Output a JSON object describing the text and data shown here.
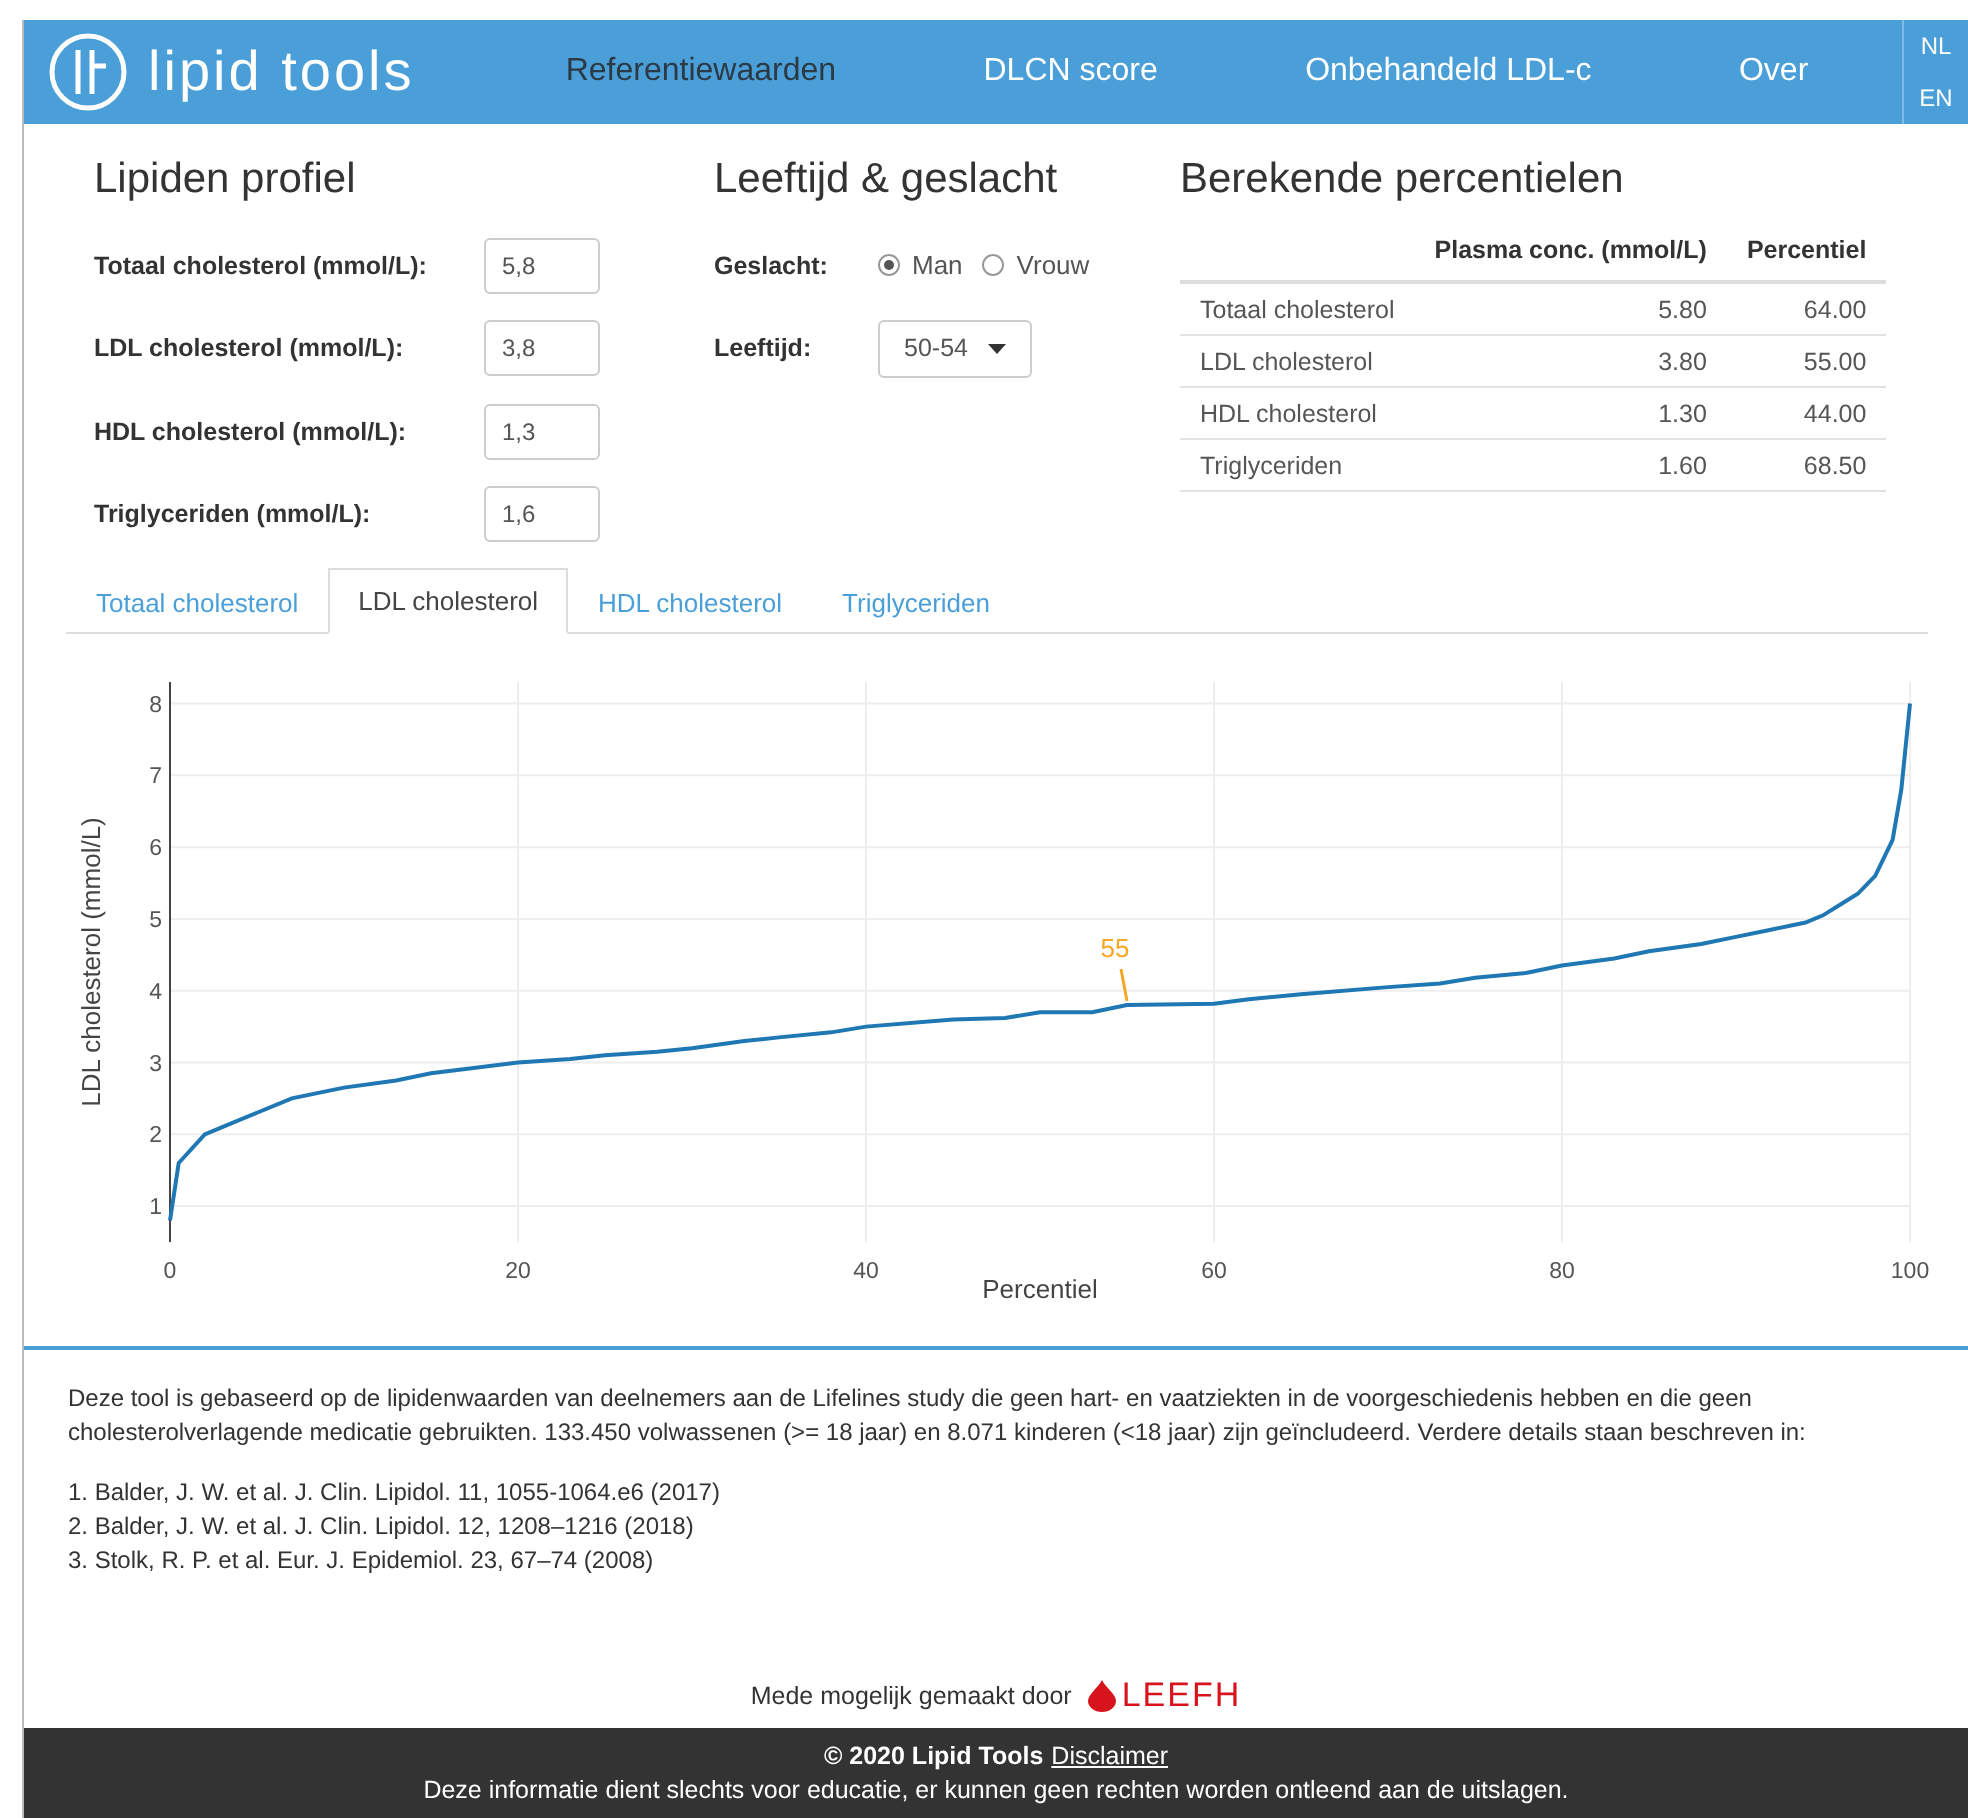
{
  "header": {
    "logo_text": "lipid tools",
    "nav": [
      {
        "label": "Referentiewaarden",
        "selected": true
      },
      {
        "label": "DLCN score",
        "selected": false
      },
      {
        "label": "Onbehandeld LDL-c",
        "selected": false
      },
      {
        "label": "Over",
        "selected": false
      }
    ],
    "languages": [
      "NL",
      "EN"
    ]
  },
  "lipid_profile": {
    "title": "Lipiden profiel",
    "fields": [
      {
        "label": "Totaal cholesterol (mmol/L):",
        "value": "5,8"
      },
      {
        "label": "LDL cholesterol (mmol/L):",
        "value": "3,8"
      },
      {
        "label": "HDL cholesterol (mmol/L):",
        "value": "1,3"
      },
      {
        "label": "Triglyceriden (mmol/L):",
        "value": "1,6"
      }
    ]
  },
  "age_sex": {
    "title": "Leeftijd & geslacht",
    "sex": {
      "label": "Geslacht:",
      "options": [
        {
          "label": "Man",
          "selected": true
        },
        {
          "label": "Vrouw",
          "selected": false
        }
      ]
    },
    "age": {
      "label": "Leeftijd:",
      "value": "50-54"
    }
  },
  "percentiles": {
    "title": "Berekende percentielen",
    "columns": [
      "",
      "Plasma conc. (mmol/L)",
      "Percentiel"
    ],
    "rows": [
      [
        "Totaal cholesterol",
        "5.80",
        "64.00"
      ],
      [
        "LDL cholesterol",
        "3.80",
        "55.00"
      ],
      [
        "HDL cholesterol",
        "1.30",
        "44.00"
      ],
      [
        "Triglyceriden",
        "1.60",
        "68.50"
      ]
    ]
  },
  "tabs": [
    {
      "label": "Totaal cholesterol",
      "selected": false
    },
    {
      "label": "LDL cholesterol",
      "selected": true
    },
    {
      "label": "HDL cholesterol",
      "selected": false
    },
    {
      "label": "Triglyceriden",
      "selected": false
    }
  ],
  "chart_data": {
    "type": "line",
    "xlabel": "Percentiel",
    "ylabel": "LDL cholesterol (mmol/L)",
    "x": [
      0,
      0.5,
      2,
      3,
      5,
      7,
      10,
      13,
      15,
      20,
      23,
      25,
      28,
      30,
      33,
      35,
      38,
      40,
      45,
      48,
      50,
      53,
      55,
      60,
      62,
      65,
      70,
      73,
      75,
      78,
      80,
      83,
      85,
      88,
      90,
      92,
      94,
      95,
      96,
      97,
      98,
      99,
      99.5,
      100
    ],
    "grid": true,
    "series": [
      {
        "color": "#1f77b4",
        "values": [
          0.8,
          1.6,
          2.0,
          2.1,
          2.3,
          2.5,
          2.65,
          2.75,
          2.85,
          3.0,
          3.05,
          3.1,
          3.15,
          3.2,
          3.3,
          3.35,
          3.42,
          3.5,
          3.6,
          3.62,
          3.7,
          3.7,
          3.8,
          3.82,
          3.88,
          3.95,
          4.05,
          4.1,
          4.18,
          4.25,
          4.35,
          4.45,
          4.55,
          4.65,
          4.75,
          4.85,
          4.95,
          5.05,
          5.2,
          5.35,
          5.6,
          6.1,
          6.8,
          8.0
        ]
      }
    ],
    "xlim": [
      0,
      100
    ],
    "ylim": [
      0.5,
      8.3
    ],
    "xticks": [
      0,
      20,
      40,
      60,
      80,
      100
    ],
    "yticks": [
      1,
      2,
      3,
      4,
      5,
      6,
      7,
      8
    ],
    "annotations": [
      {
        "x": 55,
        "y": 3.8,
        "text": "55"
      }
    ]
  },
  "info": {
    "paragraph": "Deze tool is gebaseerd op de lipidenwaarden van deelnemers aan de Lifelines study die geen hart- en vaatziekten in de voorgeschiedenis hebben en die geen cholesterolverlagende medicatie gebruikten. 133.450 volwassenen (>= 18 jaar) en 8.071 kinderen (<18 jaar) zijn geïncludeerd. Verdere details staan beschreven in:",
    "references": [
      "1. Balder, J. W. et al. J. Clin. Lipidol. 11, 1055-1064.e6 (2017)",
      "2. Balder, J. W. et al. J. Clin. Lipidol. 12, 1208–1216 (2018)",
      "3. Stolk, R. P. et al. Eur. J. Epidemiol. 23, 67–74 (2008)"
    ]
  },
  "sponsor": {
    "text": "Mede mogelijk gemaakt door",
    "logo_text": "LEEFH"
  },
  "footer": {
    "copyright": "© 2020 Lipid Tools",
    "link": "Disclaimer",
    "note": "Deze informatie dient slechts voor educatie, er kunnen geen rechten worden ontleend aan de uitslagen."
  }
}
